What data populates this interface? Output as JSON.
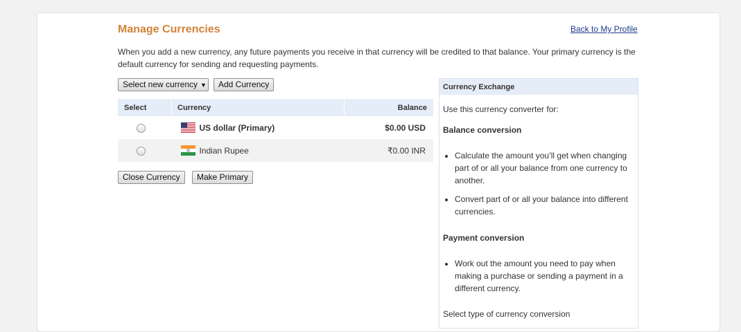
{
  "page": {
    "title": "Manage Currencies",
    "back_link": "Back to My Profile",
    "intro": "When you add a new currency, any future payments you receive in that currency will be credited to that balance. Your primary currency is the default currency for sending and requesting payments."
  },
  "controls": {
    "select_label": "Select new currency",
    "add_label": "Add Currency",
    "close_label": "Close Currency",
    "primary_label": "Make Primary"
  },
  "table": {
    "headers": {
      "select": "Select",
      "currency": "Currency",
      "balance": "Balance"
    },
    "rows": [
      {
        "currency": "US dollar (Primary)",
        "balance": "$0.00 USD",
        "flag": "us-flag-icon"
      },
      {
        "currency": "Indian Rupee",
        "balance": "₹0.00 INR",
        "flag": "india-flag-icon"
      }
    ]
  },
  "exchange": {
    "title": "Currency Exchange",
    "intro": "Use this currency converter for:",
    "balance_heading": "Balance conversion",
    "balance_items": [
      "Calculate the amount you’ll get when changing part of or all your balance from one currency to another.",
      "Convert part of or all your balance into different currencies."
    ],
    "payment_heading": "Payment conversion",
    "payment_items": [
      "Work out the amount you need to pay when making a purchase or sending a payment in a different currency."
    ],
    "select_type": "Select type of currency conversion"
  },
  "colors": {
    "title": "#d1833a",
    "link": "#1b3a8a",
    "header_bg": "#e5edf8"
  }
}
